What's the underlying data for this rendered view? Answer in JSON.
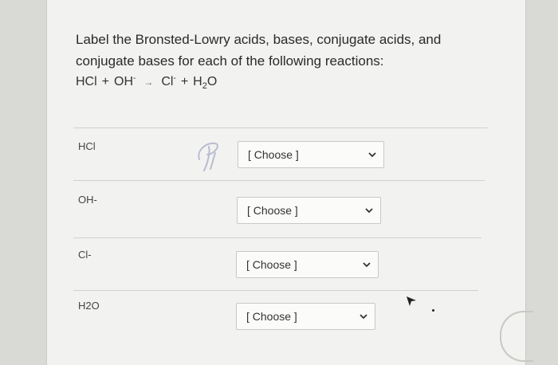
{
  "question": {
    "text": "Label the Bronsted-Lowry acids, bases, conjugate acids, and conjugate bases for each of the following reactions:"
  },
  "equation": {
    "reactant1": "HCl",
    "plus1": "+",
    "reactant2": "OH",
    "reactant2_charge": "-",
    "arrow": "→",
    "product1": "Cl",
    "product1_charge": "-",
    "plus2": "+",
    "product2_main": "H",
    "product2_sub": "2",
    "product2_end": "O"
  },
  "rows": [
    {
      "label": "HCl",
      "select": "[ Choose ]"
    },
    {
      "label": "OH-",
      "select": "[ Choose ]"
    },
    {
      "label": "Cl-",
      "select": "[ Choose ]"
    },
    {
      "label": "H2O",
      "select": "[ Choose ]"
    }
  ],
  "icons": {
    "dropdown": "chevron-down-icon",
    "cursor": "mouse-pointer-icon"
  }
}
